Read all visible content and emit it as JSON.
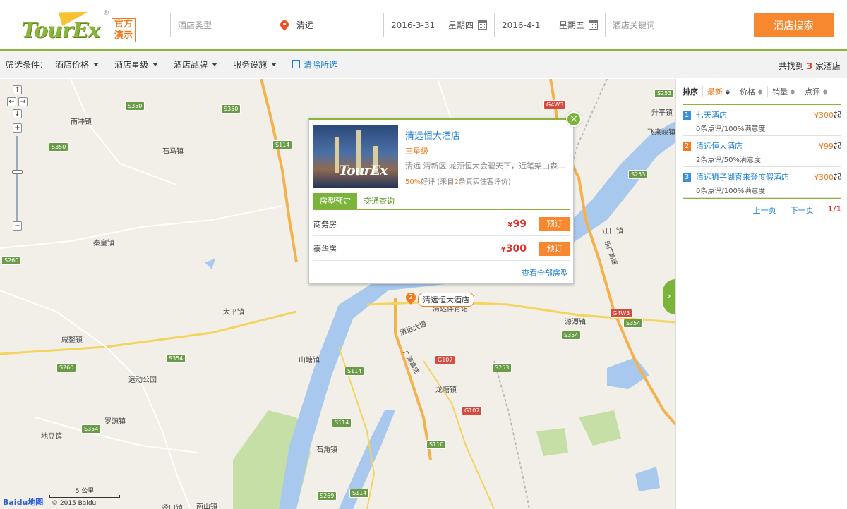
{
  "logo": {
    "text": "TourEx",
    "badge_line1": "官方",
    "badge_line2": "演示",
    "reg": "®"
  },
  "search": {
    "hotel_type_placeholder": "酒店类型",
    "city": "清远",
    "checkin_date": "2016-3-31",
    "checkin_weekday": "星期四",
    "checkout_date": "2016-4-1",
    "checkout_weekday": "星期五",
    "keyword_placeholder": "酒店关键词",
    "search_button": "酒店搜索"
  },
  "filters": {
    "label": "筛选条件：",
    "items": [
      "酒店价格",
      "酒店星级",
      "酒店品牌",
      "服务设施"
    ],
    "clear": "清除所选",
    "found_prefix": "共找到",
    "found_count": "3",
    "found_suffix": "家酒店"
  },
  "map": {
    "places": [
      {
        "name": "南冲镇"
      },
      {
        "name": "石马镇"
      },
      {
        "name": "秦皇镇"
      },
      {
        "name": "大平镇"
      },
      {
        "name": "威整镇"
      },
      {
        "name": "运动公园"
      },
      {
        "name": "罗源镇"
      },
      {
        "name": "地豆镇"
      },
      {
        "name": "山塘镇"
      },
      {
        "name": "石角镇"
      },
      {
        "name": "龙塘镇"
      },
      {
        "name": "源潭镇"
      },
      {
        "name": "江口镇"
      },
      {
        "name": "升平镇"
      },
      {
        "name": "飞来峡镇"
      },
      {
        "name": "清远体育馆"
      },
      {
        "name": "清远大道"
      },
      {
        "name": "南山镇"
      },
      {
        "name": "迳口镇"
      },
      {
        "name": "广清高速"
      },
      {
        "name": "乐广高速"
      }
    ],
    "roads": [
      "S350",
      "S350",
      "S350",
      "S114",
      "S260",
      "S260",
      "S354",
      "S354",
      "S354",
      "S114",
      "S114",
      "S253",
      "S253",
      "S253",
      "S354",
      "G4W3",
      "G4W3",
      "G107",
      "G107",
      "S110",
      "S269",
      "S114"
    ],
    "marker_number": "2",
    "marker_label": "清远恒大酒店",
    "scale": "5 公里",
    "baidu_left": "Bai",
    "baidu_right": "du地图",
    "copyright": "© 2015 Baidu",
    "expand_icon": "chevron-right-icon"
  },
  "popup": {
    "hotel_name": "清远恒大酒店",
    "star": "三星级",
    "address": "清远 清新区 龙颈恒大会碧天下，近笔架山森林...",
    "rating_pct": "50%",
    "rating_text_1": "好评 (来自",
    "rating_count": "2",
    "rating_text_2": "条真实住客评价)",
    "image_text": "TourEx",
    "tabs": [
      "房型预定",
      "交通查询"
    ],
    "rooms": [
      {
        "name": "商务房",
        "currency": "¥",
        "price": "99",
        "button": "预订"
      },
      {
        "name": "豪华房",
        "currency": "¥",
        "price": "300",
        "button": "预订"
      }
    ],
    "see_all": "查看全部房型"
  },
  "sidebar": {
    "sort_label": "排序",
    "sort_items": [
      "最新",
      "价格",
      "销量",
      "点评"
    ],
    "hotels": [
      {
        "num": "1",
        "name": "七天酒店",
        "price": "¥300",
        "unit": "起",
        "sub": "0条点评/100%满意度",
        "color": "#3a8fd8"
      },
      {
        "num": "2",
        "name": "清远恒大酒店",
        "price": "¥99",
        "unit": "起",
        "sub": "2条点评/50%满意度",
        "color": "#f07a1e"
      },
      {
        "num": "3",
        "name": "清远狮子湖喜来登度假酒店",
        "price": "¥300",
        "unit": "起",
        "sub": "0条点评/100%满意度",
        "color": "#3a8fd8"
      }
    ],
    "prev": "上一页",
    "next": "下一页",
    "page": "1/1"
  }
}
